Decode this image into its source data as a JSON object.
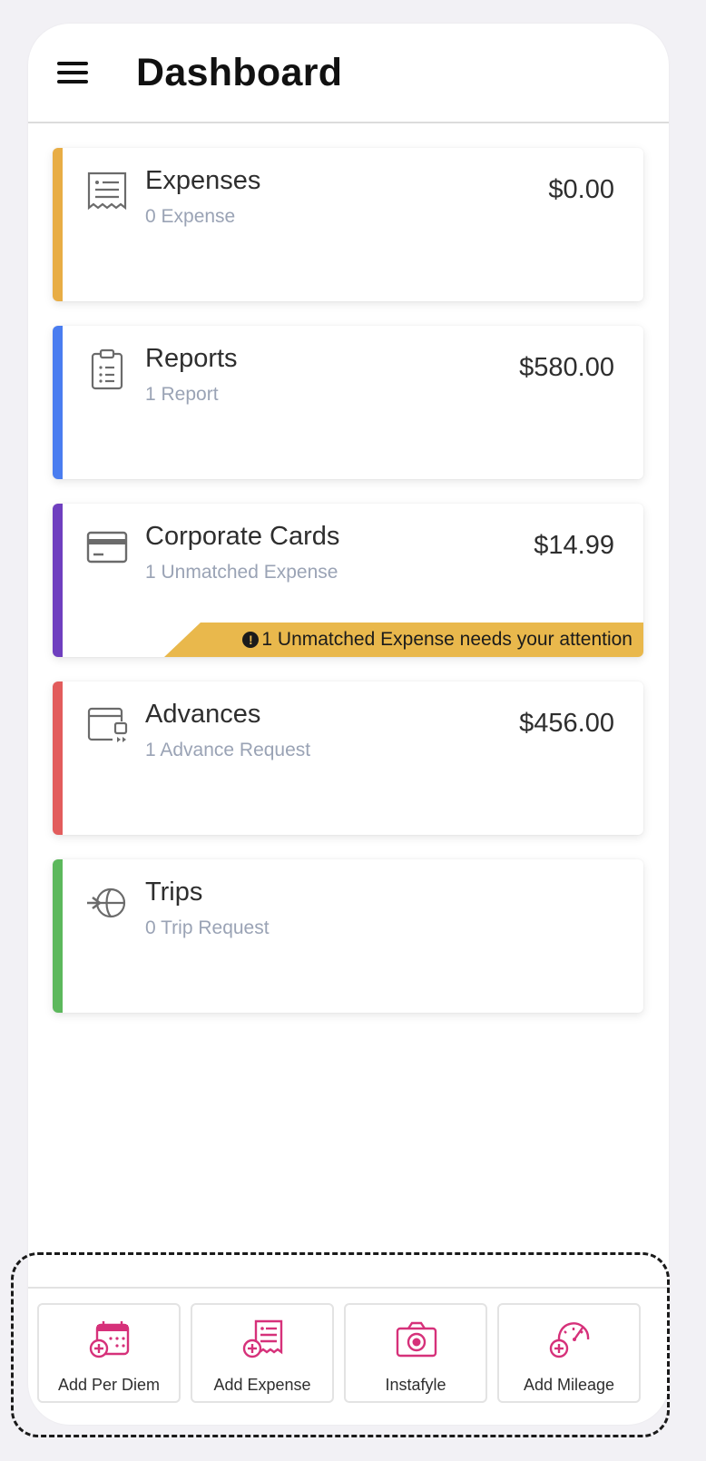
{
  "header": {
    "title": "Dashboard"
  },
  "cards": [
    {
      "name": "Expenses",
      "sub": "0 Expense",
      "amount": "$0.00",
      "color": "#e8ad45",
      "icon": "receipt-icon"
    },
    {
      "name": "Reports",
      "sub": "1 Report",
      "amount": "$580.00",
      "color": "#4a7df0",
      "icon": "clipboard-icon"
    },
    {
      "name": "Corporate Cards",
      "sub": "1 Unmatched Expense",
      "amount": "$14.99",
      "color": "#6f3fbf",
      "icon": "credit-card-icon",
      "alert": "1 Unmatched Expense needs your attention",
      "alert_color": "#e9b84c"
    },
    {
      "name": "Advances",
      "sub": "1 Advance Request",
      "amount": "$456.00",
      "color": "#e25c5c",
      "icon": "advance-wallet-icon"
    },
    {
      "name": "Trips",
      "sub": "0 Trip Request",
      "color": "#5cb85c",
      "icon": "airplane-globe-icon"
    }
  ],
  "actions": [
    {
      "label": "Add Per Diem",
      "icon": "calendar-add-icon"
    },
    {
      "label": "Add Expense",
      "icon": "receipt-add-icon"
    },
    {
      "label": "Instafyle",
      "icon": "camera-icon"
    },
    {
      "label": "Add Mileage",
      "icon": "speedometer-add-icon"
    }
  ],
  "accent_color": "#d6317a"
}
